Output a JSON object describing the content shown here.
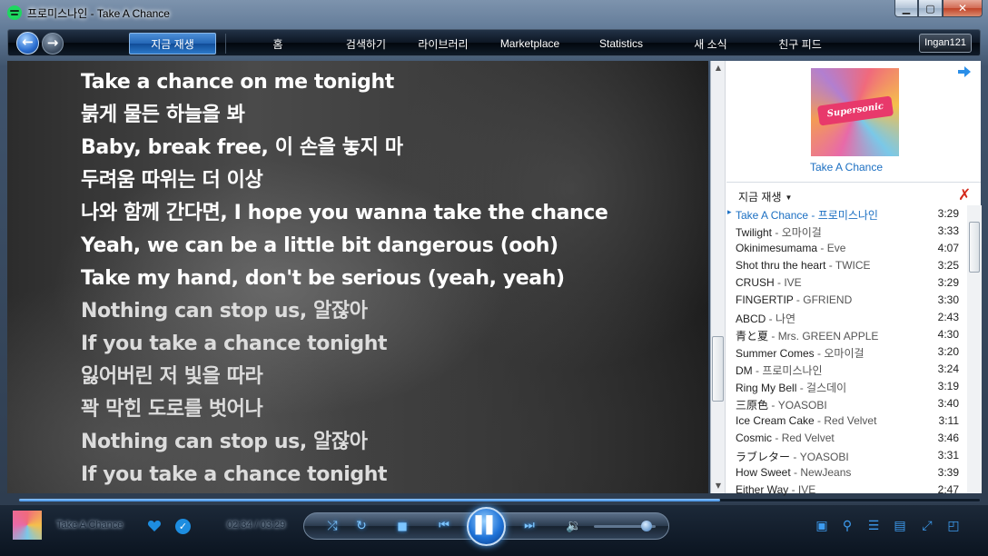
{
  "window": {
    "title": "프로미스나인 - Take A Chance",
    "minimize_label": "▁",
    "maximize_label": "▢",
    "close_label": "✕"
  },
  "nav": {
    "back_label": "←",
    "forward_label": "→",
    "tabs": [
      {
        "label": "지금 재생",
        "active": true
      },
      {
        "label": "홈"
      },
      {
        "label": "검색하기"
      },
      {
        "label": "라이브러리"
      },
      {
        "label": "Marketplace"
      },
      {
        "label": "Statistics"
      },
      {
        "label": "새 소식"
      },
      {
        "label": "친구 피드"
      }
    ],
    "user": "Ingan121"
  },
  "lyrics": {
    "lines": [
      {
        "text": "Take a chance on me tonight",
        "state": "past"
      },
      {
        "text": "붉게 물든 하늘을 봐",
        "state": "past"
      },
      {
        "text": "Baby, break free, 이 손을 놓지 마",
        "state": "past"
      },
      {
        "text": "두려움 따위는 더 이상",
        "state": "past"
      },
      {
        "text": "나와 함께 간다면, I hope you wanna take the chance",
        "state": "past"
      },
      {
        "text": "Yeah, we can be a little bit dangerous (ooh)",
        "state": "past"
      },
      {
        "text": "Take my hand, don't be serious (yeah, yeah)",
        "state": "current"
      },
      {
        "text": "Nothing can stop us, 알잖아",
        "state": "upcoming"
      },
      {
        "text": "If you take a chance tonight",
        "state": "upcoming"
      },
      {
        "text": "잃어버린 저 빛을 따라",
        "state": "upcoming"
      },
      {
        "text": "꽉 막힌 도로를 벗어나",
        "state": "upcoming"
      },
      {
        "text": "Nothing can stop us, 알잖아",
        "state": "upcoming"
      },
      {
        "text": "If you take a chance tonight",
        "state": "upcoming"
      }
    ]
  },
  "sidebar": {
    "album_caption": "Take A Chance",
    "album_banner": "Supersonic",
    "queue_label": "지금 재생",
    "queue": [
      {
        "title": "Take A Chance",
        "artist": "프로미스나인",
        "duration": "3:29",
        "current": true
      },
      {
        "title": "Twilight",
        "artist": "오마이걸",
        "duration": "3:33"
      },
      {
        "title": "Okinimesumama",
        "artist": "Eve",
        "duration": "4:07"
      },
      {
        "title": "Shot thru the heart",
        "artist": "TWICE",
        "duration": "3:25"
      },
      {
        "title": "CRUSH",
        "artist": " IVE",
        "duration": "3:29"
      },
      {
        "title": "FINGERTIP",
        "artist": "GFRIEND",
        "duration": "3:30"
      },
      {
        "title": "ABCD",
        "artist": "나연",
        "duration": "2:43"
      },
      {
        "title": "青と夏",
        "artist": " Mrs. GREEN APPLE",
        "duration": "4:30"
      },
      {
        "title": "Summer Comes",
        "artist": "오마이걸",
        "duration": "3:20"
      },
      {
        "title": "DM",
        "artist": "프로미스나인",
        "duration": "3:24"
      },
      {
        "title": "Ring My Bell",
        "artist": "걸스데이",
        "duration": "3:19"
      },
      {
        "title": "三原色",
        "artist": " YOASOBI",
        "duration": "3:40"
      },
      {
        "title": "Ice Cream Cake",
        "artist": "Red Velvet",
        "duration": "3:11"
      },
      {
        "title": "Cosmic",
        "artist": "Red Velvet",
        "duration": "3:46"
      },
      {
        "title": "ラブレター",
        "artist": " YOASOBI",
        "duration": "3:31"
      },
      {
        "title": "How Sweet",
        "artist": "NewJeans",
        "duration": "3:39"
      },
      {
        "title": "Either Way",
        "artist": "IVE",
        "duration": "2:47"
      }
    ]
  },
  "player": {
    "now_playing": "Take A Chance",
    "time": "02:34 / 03:29",
    "progress": 0.73,
    "volume": 0.85,
    "accent": "#1b6fc2"
  }
}
